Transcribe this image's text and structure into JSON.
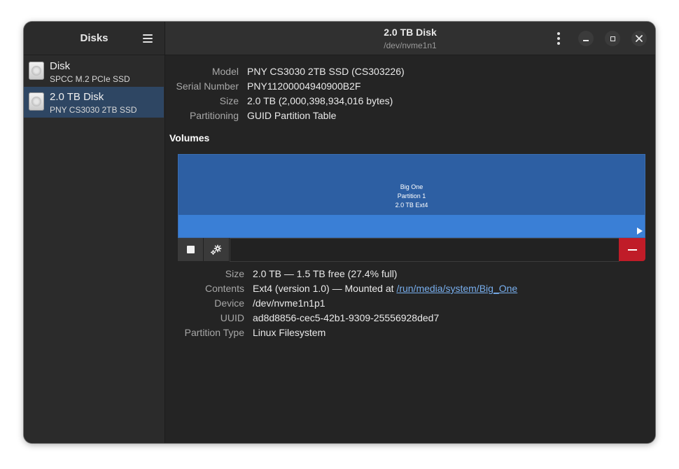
{
  "sidebar": {
    "title": "Disks",
    "disks": [
      {
        "name": "Disk",
        "subtitle": "SPCC M.2 PCIe SSD"
      },
      {
        "name": "2.0 TB Disk",
        "subtitle": "PNY CS3030 2TB SSD"
      }
    ]
  },
  "header": {
    "title": "2.0 TB Disk",
    "subtitle": "/dev/nvme1n1"
  },
  "drive": {
    "model_label": "Model",
    "model": "PNY CS3030 2TB SSD (CS303226)",
    "serial_label": "Serial Number",
    "serial": "PNY11200004940900B2F",
    "size_label": "Size",
    "size": "2.0 TB (2,000,398,934,016 bytes)",
    "partitioning_label": "Partitioning",
    "partitioning": "GUID Partition Table"
  },
  "volumes": {
    "title": "Volumes",
    "partition": {
      "name": "Big One",
      "label": "Partition 1",
      "desc": "2.0 TB Ext4"
    }
  },
  "volume_info": {
    "size_label": "Size",
    "size": "2.0 TB — 1.5 TB free (27.4% full)",
    "contents_label": "Contents",
    "contents_prefix": "Ext4 (version 1.0) — Mounted at ",
    "mount_point": "/run/media/system/Big_One",
    "device_label": "Device",
    "device": "/dev/nvme1n1p1",
    "uuid_label": "UUID",
    "uuid": "ad8d8856-cec5-42b1-9309-25556928ded7",
    "ptype_label": "Partition Type",
    "ptype": "Linux Filesystem"
  },
  "icons": {
    "menu": "hamburger-menu-icon",
    "more": "kebab-menu-icon",
    "minimize": "minimize-icon",
    "maximize": "maximize-icon",
    "close": "close-icon",
    "stop": "stop-icon",
    "settings": "gears-icon",
    "remove": "minus-icon",
    "next": "play-arrow-icon",
    "disk": "drive-harddisk-icon"
  },
  "colors": {
    "accent": "#3a7fd6",
    "partition_fill": "#2d5fa3",
    "destructive": "#c01c28",
    "selected_row": "#2e4663",
    "link": "#78aeed"
  }
}
